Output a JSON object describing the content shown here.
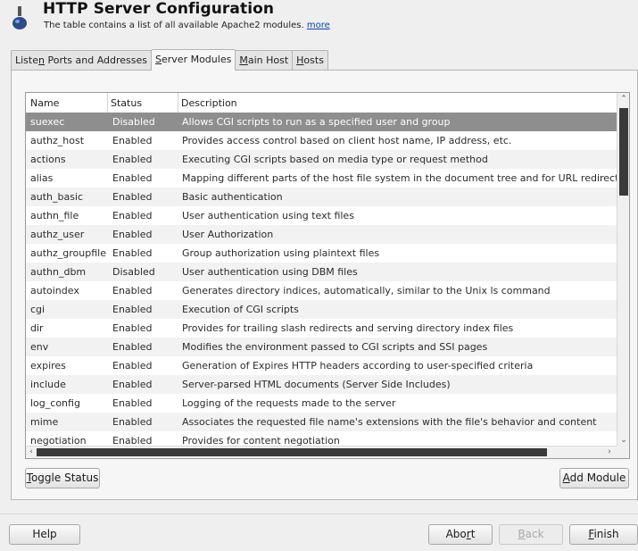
{
  "header": {
    "title": "HTTP Server Configuration",
    "subtitle": "The table contains a list of all available Apache2 modules.",
    "more_link": "more"
  },
  "tabs": [
    {
      "pre": "Liste",
      "key": "n",
      "post": " Ports and Addresses"
    },
    {
      "pre": "",
      "key": "S",
      "post": "erver Modules"
    },
    {
      "pre": "",
      "key": "M",
      "post": "ain Host"
    },
    {
      "pre": "",
      "key": "H",
      "post": "osts"
    }
  ],
  "table": {
    "columns": [
      "Name",
      "Status",
      "Description"
    ],
    "rows": [
      {
        "name": "suexec",
        "status": "Disabled",
        "description": "Allows CGI scripts to run as a specified user and group"
      },
      {
        "name": "authz_host",
        "status": "Enabled",
        "description": "Provides access control based on client host name, IP address, etc."
      },
      {
        "name": "actions",
        "status": "Enabled",
        "description": "Executing CGI scripts based on media type or request method"
      },
      {
        "name": "alias",
        "status": "Enabled",
        "description": "Mapping different parts of the host file system in the document tree and for URL redirect"
      },
      {
        "name": "auth_basic",
        "status": "Enabled",
        "description": "Basic authentication"
      },
      {
        "name": "authn_file",
        "status": "Enabled",
        "description": "User authentication using text files"
      },
      {
        "name": "authz_user",
        "status": "Enabled",
        "description": "User Authorization"
      },
      {
        "name": "authz_groupfile",
        "status": "Enabled",
        "description": "Group authorization using plaintext files"
      },
      {
        "name": "authn_dbm",
        "status": "Disabled",
        "description": "User authentication using DBM files"
      },
      {
        "name": "autoindex",
        "status": "Enabled",
        "description": "Generates directory indices, automatically, similar to the Unix ls command"
      },
      {
        "name": "cgi",
        "status": "Enabled",
        "description": "Execution of CGI scripts"
      },
      {
        "name": "dir",
        "status": "Enabled",
        "description": "Provides for trailing slash redirects and serving directory index files"
      },
      {
        "name": "env",
        "status": "Enabled",
        "description": "Modifies the environment passed to CGI scripts and SSI pages"
      },
      {
        "name": "expires",
        "status": "Enabled",
        "description": "Generation of Expires HTTP headers according to user-specified criteria"
      },
      {
        "name": "include",
        "status": "Enabled",
        "description": "Server-parsed HTML documents (Server Side Includes)"
      },
      {
        "name": "log_config",
        "status": "Enabled",
        "description": "Logging of the requests made to the server"
      },
      {
        "name": "mime",
        "status": "Enabled",
        "description": "Associates the requested file name's extensions with the file's behavior and content"
      },
      {
        "name": "negotiation",
        "status": "Enabled",
        "description": "Provides for content negotiation"
      }
    ]
  },
  "buttons": {
    "toggle_status": {
      "key": "T",
      "post": "oggle Status"
    },
    "add_module": {
      "key": "A",
      "post": "dd Module"
    },
    "help": "Help",
    "abort": {
      "pre": "Abo",
      "key": "r",
      "post": "t"
    },
    "back": {
      "key": "B",
      "post": "ack"
    },
    "finish": {
      "key": "F",
      "post": "inish"
    }
  },
  "colors": {
    "selected_row": "#8e8e8e",
    "link": "#0645ad"
  }
}
